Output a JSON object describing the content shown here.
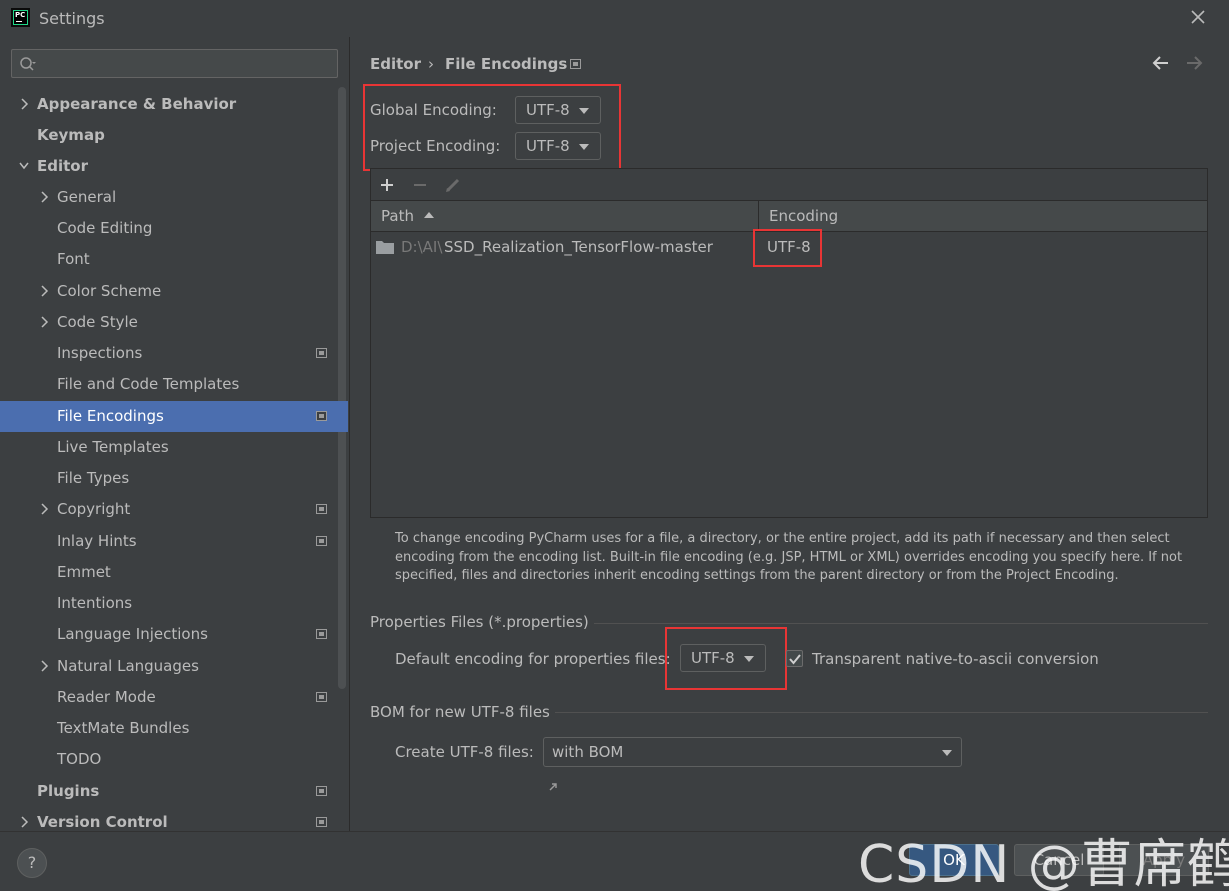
{
  "window": {
    "title": "Settings",
    "logo_text": "PC"
  },
  "search": {
    "placeholder": "",
    "value": ""
  },
  "sidebar": {
    "items": [
      {
        "label": "Appearance & Behavior",
        "bold": true,
        "chevron": "right"
      },
      {
        "label": "Keymap",
        "bold": true,
        "chevron": "none"
      },
      {
        "label": "Editor",
        "bold": true,
        "chevron": "down"
      },
      {
        "label": "General",
        "chevron": "right"
      },
      {
        "label": "Code Editing"
      },
      {
        "label": "Font"
      },
      {
        "label": "Color Scheme",
        "chevron": "right"
      },
      {
        "label": "Code Style",
        "chevron": "right"
      },
      {
        "label": "Inspections",
        "page_icon": true
      },
      {
        "label": "File and Code Templates"
      },
      {
        "label": "File Encodings",
        "selected": true,
        "page_icon": true
      },
      {
        "label": "Live Templates"
      },
      {
        "label": "File Types"
      },
      {
        "label": "Copyright",
        "chevron": "right",
        "page_icon": true
      },
      {
        "label": "Inlay Hints",
        "page_icon": true
      },
      {
        "label": "Emmet"
      },
      {
        "label": "Intentions"
      },
      {
        "label": "Language Injections",
        "page_icon": true
      },
      {
        "label": "Natural Languages",
        "chevron": "right"
      },
      {
        "label": "Reader Mode",
        "page_icon": true
      },
      {
        "label": "TextMate Bundles"
      },
      {
        "label": "TODO"
      },
      {
        "label": "Plugins",
        "bold": true,
        "page_icon": true
      },
      {
        "label": "Version Control",
        "bold": true,
        "chevron": "right",
        "page_icon": true
      }
    ]
  },
  "breadcrumb": {
    "parent": "Editor",
    "separator": "›",
    "current": "File Encodings"
  },
  "encoding": {
    "global_label": "Global Encoding:",
    "global_value": "UTF-8",
    "project_label": "Project Encoding:",
    "project_value": "UTF-8"
  },
  "table": {
    "columns": [
      "Path",
      "Encoding"
    ],
    "rows": [
      {
        "path_prefix": "D:\\AI\\",
        "path_main": "SSD_Realization_TensorFlow-master",
        "encoding": "UTF-8"
      }
    ]
  },
  "help_text": "To change encoding PyCharm uses for a file, a directory, or the entire project, add its path if necessary and then select encoding from the encoding list. Built-in file encoding (e.g. JSP, HTML or XML) overrides encoding you specify here. If not specified, files and directories inherit encoding settings from the parent directory or from the Project Encoding.",
  "properties": {
    "section_title": "Properties Files (*.properties)",
    "default_label": "Default encoding for properties files:",
    "default_value": "UTF-8",
    "native_label": "Transparent native-to-ascii conversion",
    "native_checked": true
  },
  "bom": {
    "section_title": "BOM for new UTF-8 files",
    "create_label": "Create UTF-8 files:",
    "create_value": "with BOM"
  },
  "footer": {
    "help": "?",
    "ok": "OK",
    "cancel": "Cancel",
    "apply": "Apply"
  },
  "watermark": "CSDN @曹席鹤",
  "colors": {
    "background": "#3c3f41",
    "selection": "#4b6eaf",
    "highlight_box": "#e83535",
    "ok_button": "#365880"
  }
}
